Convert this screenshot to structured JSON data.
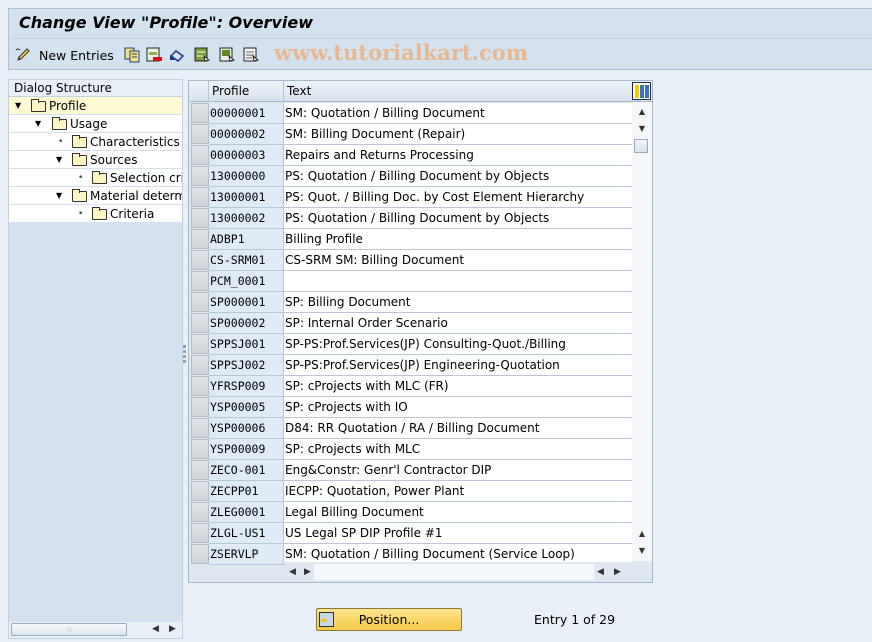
{
  "window": {
    "title": "Change View \"Profile\": Overview"
  },
  "toolbar": {
    "new_entries_label": "New Entries",
    "icons": [
      "edit-pencil-icon",
      "copy-icon",
      "delete-icon",
      "undo-icon",
      "select-all-icon",
      "select-block-icon",
      "deselect-all-icon"
    ],
    "watermark": "www.tutorialkart.com"
  },
  "dialog_structure": {
    "header": "Dialog Structure",
    "items": [
      {
        "label": "Profile",
        "level": 0,
        "expander": "expanded",
        "selected": true
      },
      {
        "label": "Usage",
        "level": 1,
        "expander": "expanded",
        "selected": false
      },
      {
        "label": "Characteristics",
        "level": 2,
        "expander": "leaf",
        "selected": false
      },
      {
        "label": "Sources",
        "level": 2,
        "expander": "expanded",
        "selected": false
      },
      {
        "label": "Selection crit",
        "level": 3,
        "expander": "leaf",
        "selected": false
      },
      {
        "label": "Material determin",
        "level": 2,
        "expander": "expanded",
        "selected": false
      },
      {
        "label": "Criteria",
        "level": 3,
        "expander": "leaf",
        "selected": false
      }
    ]
  },
  "table": {
    "columns": [
      "Profile",
      "Text"
    ],
    "rows": [
      [
        "00000001",
        "SM: Quotation / Billing Document"
      ],
      [
        "00000002",
        "SM: Billing Document (Repair)"
      ],
      [
        "00000003",
        "Repairs and Returns Processing"
      ],
      [
        "13000000",
        "PS: Quotation / Billing Document by Objects"
      ],
      [
        "13000001",
        "PS: Quot. / Billing Doc. by Cost Element Hierarchy"
      ],
      [
        "13000002",
        "PS: Quotation / Billing Document by Objects"
      ],
      [
        "ADBP1",
        "Billing Profile"
      ],
      [
        "CS-SRM01",
        "CS-SRM SM: Billing Document"
      ],
      [
        "PCM_0001",
        ""
      ],
      [
        "SP000001",
        "SP: Billing Document"
      ],
      [
        "SP000002",
        "SP: Internal Order Scenario"
      ],
      [
        "SPPSJ001",
        "SP-PS:Prof.Services(JP) Consulting-Quot./Billing"
      ],
      [
        "SPPSJ002",
        "SP-PS:Prof.Services(JP) Engineering-Quotation"
      ],
      [
        "YFRSP009",
        "SP: cProjects with MLC (FR)"
      ],
      [
        "YSP00005",
        "SP: cProjects with IO"
      ],
      [
        "YSP00006",
        "D84: RR Quotation / RA / Billing Document"
      ],
      [
        "YSP00009",
        "SP: cProjects with MLC"
      ],
      [
        "ZECO-001",
        "Eng&Constr: Genr'l Contractor DIP"
      ],
      [
        "ZECPP01",
        "IECPP: Quotation, Power Plant"
      ],
      [
        "ZLEG0001",
        "Legal Billing Document"
      ],
      [
        "ZLGL-US1",
        "US Legal SP DIP Profile #1"
      ],
      [
        "ZSERVLP",
        "SM: Quotation / Billing Document (Service Loop)"
      ]
    ]
  },
  "footer": {
    "position_button": "Position...",
    "entry_info": "Entry 1 of 29"
  },
  "colors": {
    "selected_tree_row": "#fefbd3",
    "key_column_bg": "#deebf7",
    "position_button": "#f6c948",
    "watermark": "#e8b890"
  }
}
